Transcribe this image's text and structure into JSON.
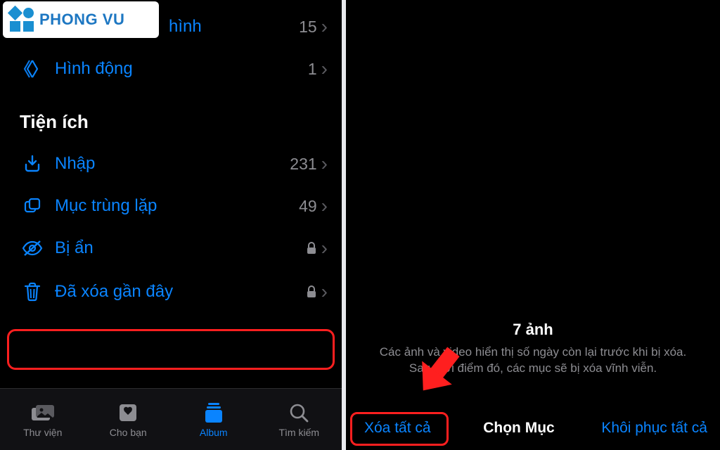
{
  "logo": {
    "text": "PHONG VU"
  },
  "left": {
    "rows": [
      {
        "icon": "chevrons",
        "label": "hình",
        "count": "15"
      },
      {
        "icon": "live",
        "label": "Hình động",
        "count": "1"
      }
    ],
    "section_title": "Tiện ích",
    "utilities": [
      {
        "icon": "import",
        "label": "Nhập",
        "count": "231",
        "lock": false
      },
      {
        "icon": "duplicate",
        "label": "Mục trùng lặp",
        "count": "49",
        "lock": false
      },
      {
        "icon": "hidden",
        "label": "Bị ẩn",
        "count": "",
        "lock": true
      },
      {
        "icon": "trash",
        "label": "Đã xóa gần đây",
        "count": "",
        "lock": true
      }
    ],
    "tabs": [
      {
        "icon": "library",
        "label": "Thư viện",
        "active": false
      },
      {
        "icon": "foryou",
        "label": "Cho bạn",
        "active": false
      },
      {
        "icon": "album",
        "label": "Album",
        "active": true
      },
      {
        "icon": "search",
        "label": "Tìm kiếm",
        "active": false
      }
    ]
  },
  "right": {
    "title": "7 ảnh",
    "desc_line1": "Các ảnh và video hiển thị số ngày còn lại trước khi bị xóa.",
    "desc_line2": "Sau thời điểm đó, các mục sẽ bị xóa vĩnh viễn.",
    "delete_all": "Xóa tất cả",
    "select": "Chọn Mục",
    "recover_all": "Khôi phục tất cả"
  }
}
